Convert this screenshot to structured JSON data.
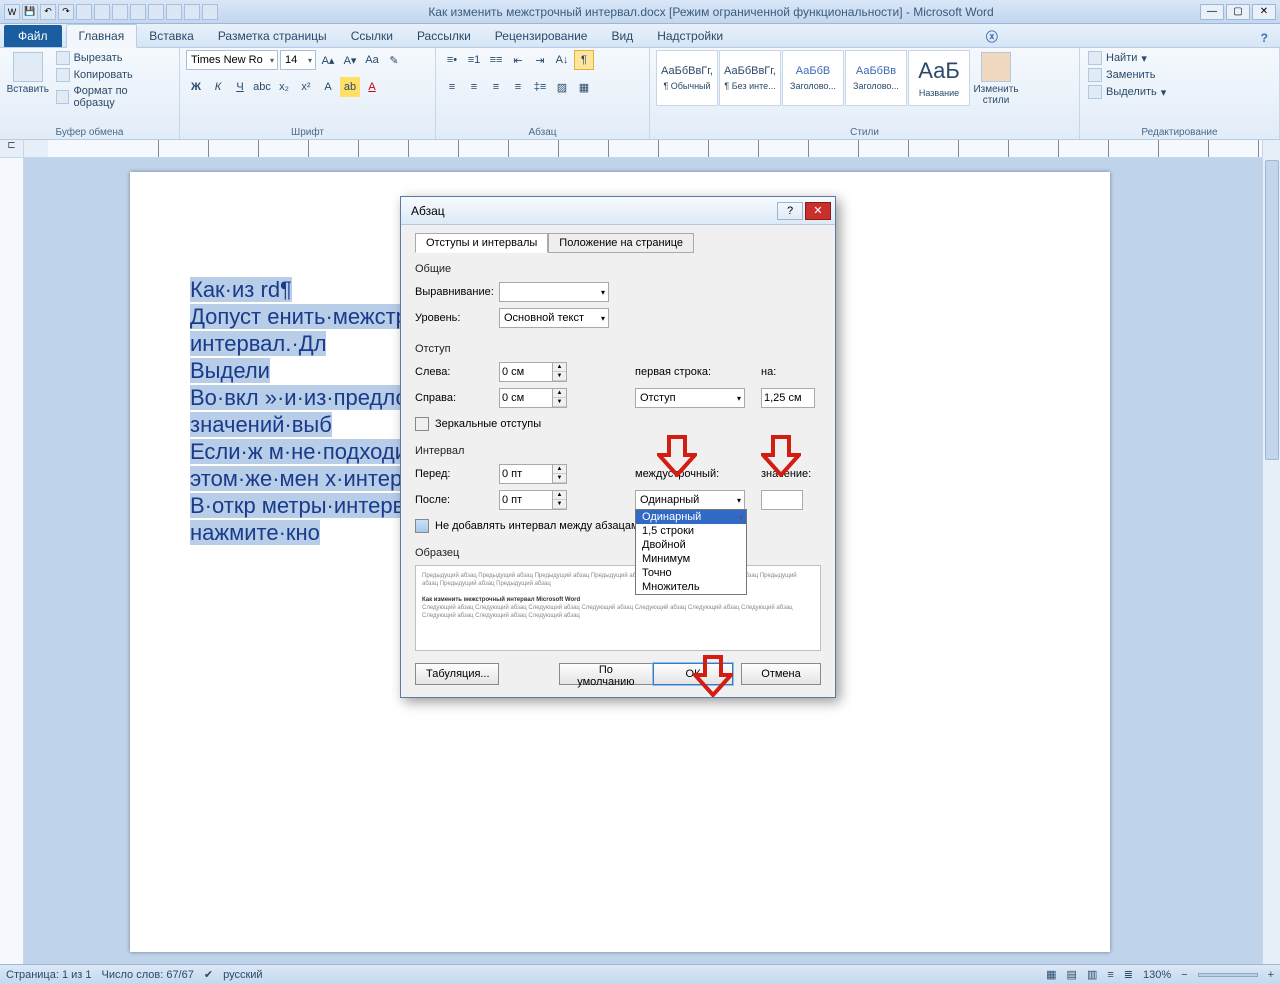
{
  "title": "Как изменить межстрочный интервал.docx [Режим ограниченной функциональности] - Microsoft Word",
  "ribbon": {
    "file": "Файл",
    "tabs": [
      "Главная",
      "Вставка",
      "Разметка страницы",
      "Ссылки",
      "Рассылки",
      "Рецензирование",
      "Вид",
      "Надстройки"
    ],
    "active_tab": "Главная",
    "clipboard": {
      "label": "Буфер обмена",
      "paste": "Вставить",
      "cut": "Вырезать",
      "copy": "Копировать",
      "fmt": "Формат по образцу"
    },
    "font": {
      "label": "Шрифт",
      "name": "Times New Ro",
      "size": "14"
    },
    "para": {
      "label": "Абзац"
    },
    "styles": {
      "label": "Стили",
      "items": [
        {
          "prev": "АаБбВвГг,",
          "name": "¶ Обычный"
        },
        {
          "prev": "АаБбВвГг,",
          "name": "¶ Без инте..."
        },
        {
          "prev": "АаБбВ",
          "name": "Заголово...",
          "blue": true
        },
        {
          "prev": "АаБбВв",
          "name": "Заголово...",
          "blue": true
        },
        {
          "prev": "АаБ",
          "name": "Название",
          "big": true,
          "blue": false
        }
      ],
      "change": "Изменить стили"
    },
    "editing": {
      "label": "Редактирование",
      "find": "Найти",
      "replace": "Заменить",
      "select": "Выделить"
    }
  },
  "doc_lines": [
    "Как·из                                                          rd¶",
    "Допуст                                                          енить·межстрочный·",
    "интервал.·Дл",
    "Выдели",
    "Во·вкл                                                          »·и·из·предложенных·",
    "значений·выб",
    "Если·ж                                                          м·не·подходит,·то·в·",
    "этом·же·мен                                                          х·интервалов»¶",
    "В·откр                                                          метры·интервала·и·",
    "нажмите·кно"
  ],
  "dialog": {
    "title": "Абзац",
    "tab1": "Отступы и интервалы",
    "tab2": "Положение на странице",
    "sec_general": "Общие",
    "align_lbl": "Выравнивание:",
    "level_lbl": "Уровень:",
    "level_val": "Основной текст",
    "sec_indent": "Отступ",
    "left_lbl": "Слева:",
    "left_val": "0 см",
    "right_lbl": "Справа:",
    "right_val": "0 см",
    "firstline_lbl": "первая строка:",
    "firstline_val": "Отступ",
    "by_lbl": "на:",
    "by_val": "1,25 см",
    "mirror": "Зеркальные отступы",
    "sec_spacing": "Интервал",
    "before_lbl": "Перед:",
    "before_val": "0 пт",
    "after_lbl": "После:",
    "after_val": "0 пт",
    "linesp_lbl": "междустрочный:",
    "linesp_val": "Одинарный",
    "value_lbl": "значение:",
    "value_val": "",
    "noadd": "Не добавлять интервал между абзацам",
    "preview": "Образец",
    "tabs_btn": "Табуляция...",
    "default_btn": "По умолчанию",
    "ok": "ОК",
    "cancel": "Отмена",
    "dropdown": [
      "Одинарный",
      "1,5 строки",
      "Двойной",
      "Минимум",
      "Точно",
      "Множитель"
    ]
  },
  "status": {
    "page": "Страница: 1 из 1",
    "words": "Число слов: 67/67",
    "lang": "русский",
    "zoom": "130%"
  }
}
